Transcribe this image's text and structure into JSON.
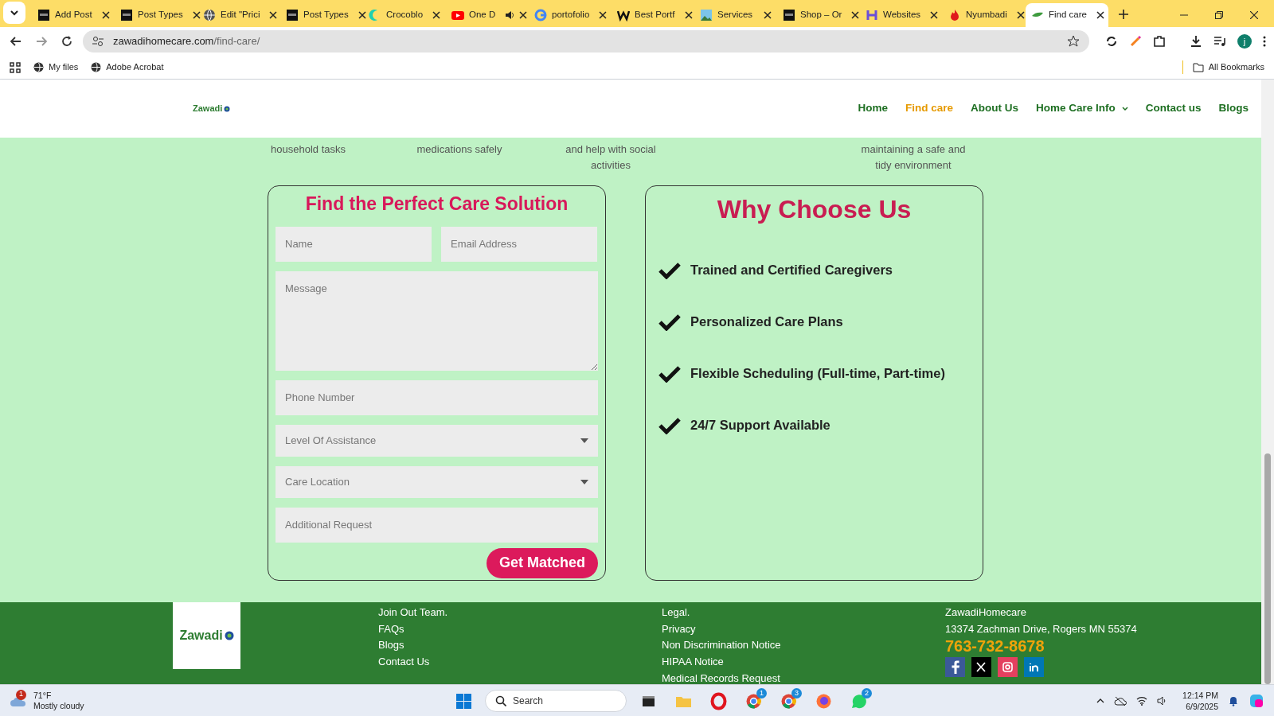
{
  "browser": {
    "tabs": [
      {
        "title": "Add Post",
        "selected": false,
        "audio": false
      },
      {
        "title": "Post Types",
        "selected": false,
        "audio": false
      },
      {
        "title": "Edit \"Prici",
        "selected": false,
        "audio": false
      },
      {
        "title": "Post Types",
        "selected": false,
        "audio": false
      },
      {
        "title": "Crocoblo",
        "selected": false,
        "audio": false
      },
      {
        "title": "One D",
        "selected": false,
        "audio": true
      },
      {
        "title": "portofolio",
        "selected": false,
        "audio": false
      },
      {
        "title": "Best Portf",
        "selected": false,
        "audio": false
      },
      {
        "title": "Services",
        "selected": false,
        "audio": false
      },
      {
        "title": "Shop – Or",
        "selected": false,
        "audio": false
      },
      {
        "title": "Websites",
        "selected": false,
        "audio": false
      },
      {
        "title": "Nyumbadi",
        "selected": false,
        "audio": false
      },
      {
        "title": "Find care",
        "selected": true,
        "audio": false
      }
    ],
    "url_host": "zawadihomecare.com",
    "url_path": "/find-care/",
    "bookmarks": [
      "My files",
      "Adobe Acrobat"
    ],
    "all_bookmarks": "All Bookmarks",
    "profile_initial": "j"
  },
  "site": {
    "logo_text": "Zawadi",
    "footer_logo_text": "Zawadi",
    "nav": [
      {
        "label": "Home",
        "selected": false,
        "dropdown": false
      },
      {
        "label": "Find care",
        "selected": true,
        "dropdown": false
      },
      {
        "label": "About Us",
        "selected": false,
        "dropdown": false
      },
      {
        "label": "Home Care Info",
        "selected": false,
        "dropdown": true
      },
      {
        "label": "Contact us",
        "selected": false,
        "dropdown": false
      },
      {
        "label": "Blogs",
        "selected": false,
        "dropdown": false
      }
    ],
    "service_snippets": [
      "household tasks",
      "medications safely",
      "and help with social activities",
      "maintaining a safe and tidy environment"
    ],
    "form": {
      "title": "Find the Perfect Care Solution",
      "fields": [
        {
          "kind": "text",
          "placeholder": "Name"
        },
        {
          "kind": "text",
          "placeholder": "Email Address"
        },
        {
          "kind": "textarea",
          "placeholder": "Message"
        },
        {
          "kind": "text",
          "placeholder": "Phone Number"
        },
        {
          "kind": "select",
          "placeholder": "Level Of Assistance"
        },
        {
          "kind": "select",
          "placeholder": "Care Location"
        },
        {
          "kind": "text",
          "placeholder": "Additional Request"
        }
      ],
      "submit": "Get Matched"
    },
    "why": {
      "title": "Why Choose Us",
      "items": [
        "Trained and Certified Caregivers",
        "Personalized Care Plans",
        "Flexible Scheduling (Full-time, Part-time)",
        "24/7 Support Available"
      ]
    },
    "footer": {
      "col1": [
        "Join Out Team.",
        "FAQs",
        "Blogs",
        "Contact Us"
      ],
      "col2": [
        "Legal.",
        "Privacy",
        "Non Discrimination Notice",
        "HIPAA Notice",
        "Medical Records Request"
      ],
      "company": "ZawadiHomecare",
      "address": "13374 Zachman Drive, Rogers MN 55374",
      "phone": "763-732-8678",
      "social": [
        {
          "kind": "facebook",
          "color": "#3b5998"
        },
        {
          "kind": "x",
          "color": "#000000"
        },
        {
          "kind": "instagram",
          "color": "#e4405f"
        },
        {
          "kind": "linkedin",
          "color": "#0077b5"
        }
      ]
    }
  },
  "taskbar": {
    "weather_badge": "1",
    "temperature": "71°F",
    "condition": "Mostly cloudy",
    "search_placeholder": "Search",
    "apps": [
      {
        "kind": "start"
      },
      {
        "kind": "terminal"
      },
      {
        "kind": "folder"
      },
      {
        "kind": "opera"
      },
      {
        "kind": "chrome",
        "badge": "1"
      },
      {
        "kind": "chrome2",
        "badge": "3"
      },
      {
        "kind": "firefox"
      },
      {
        "kind": "whatsapp",
        "badge": "2"
      }
    ],
    "time": "12:14 PM",
    "date": "6/9/2025"
  }
}
